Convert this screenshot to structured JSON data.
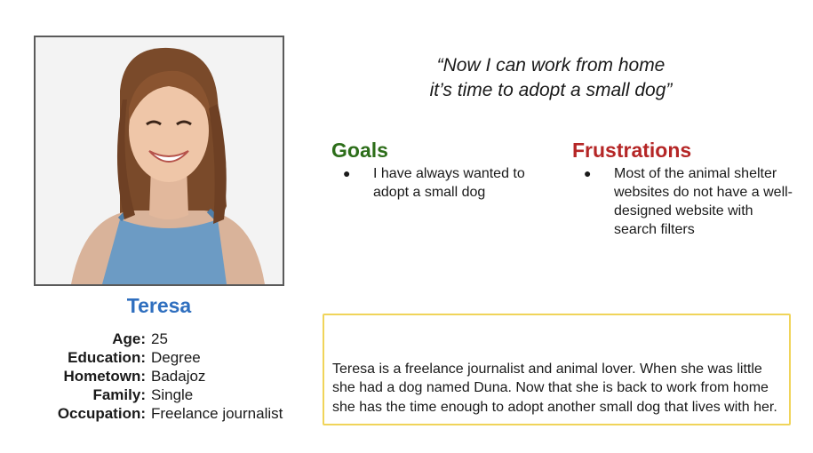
{
  "persona": {
    "name": "Teresa",
    "photo_alt": "portrait-photo",
    "details": [
      {
        "label": "Age:",
        "value": "25"
      },
      {
        "label": "Education:",
        "value": "Degree"
      },
      {
        "label": "Hometown:",
        "value": "Badajoz"
      },
      {
        "label": "Family:",
        "value": "Single"
      },
      {
        "label": "Occupation:",
        "value": "Freelance journalist"
      }
    ]
  },
  "quote": {
    "line1": "“Now I can work from home",
    "line2": "it’s time to adopt a small dog”"
  },
  "goals": {
    "title": "Goals",
    "items": [
      "I have always wanted to adopt a small dog"
    ]
  },
  "frustrations": {
    "title": "Frustrations",
    "items": [
      "Most of the animal shelter websites do not have a well-designed website with search filters"
    ]
  },
  "bio": "Teresa is a freelance journalist and animal lover. When she was little she had a dog named Duna. Now that she is back to work from home she has the time enough to adopt another small dog that lives with her.",
  "colors": {
    "name": "#2f6fbf",
    "goals": "#2d6e1a",
    "frustrations": "#b52626",
    "bio_border": "#f0d45a"
  }
}
